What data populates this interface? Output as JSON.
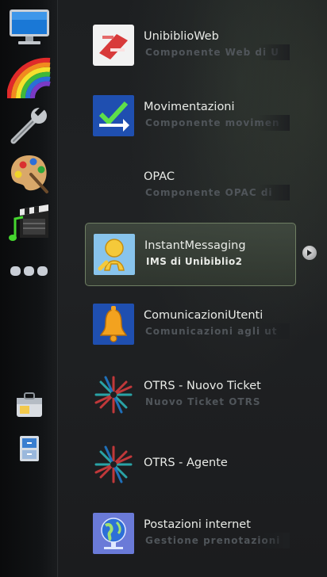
{
  "sidebar": {
    "categories": [
      {
        "icon": "computer-icon"
      },
      {
        "icon": "rainbow-icon"
      },
      {
        "icon": "wrench-icon"
      },
      {
        "icon": "palette-icon"
      },
      {
        "icon": "multimedia-icon"
      },
      {
        "icon": "more-icon"
      }
    ],
    "bottom": [
      {
        "icon": "briefcase-icon"
      },
      {
        "icon": "file-cabinet-icon"
      }
    ]
  },
  "apps": [
    {
      "title": "UnibiblioWeb",
      "subtitle": "Componente Web di U",
      "icon": "unibiblioweb-icon"
    },
    {
      "title": "Movimentazioni",
      "subtitle": "Componente movimen",
      "icon": "movimentazioni-icon"
    },
    {
      "title": "OPAC",
      "subtitle": "Componente OPAC di",
      "icon": "opac-icon"
    },
    {
      "title": "InstantMessaging",
      "subtitle": "IMS di Unibiblio2",
      "icon": "instant-messaging-icon",
      "selected": true
    },
    {
      "title": "ComunicazioniUtenti",
      "subtitle": "Comunicazioni agli ut",
      "icon": "bell-icon"
    },
    {
      "title": "OTRS - Nuovo Ticket",
      "subtitle": "Nuovo Ticket OTRS",
      "icon": "otrs-icon"
    },
    {
      "title": "OTRS - Agente",
      "subtitle": "",
      "icon": "otrs-icon"
    },
    {
      "title": "Postazioni internet",
      "subtitle": "Gestione prenotazioni",
      "icon": "globe-icon"
    }
  ],
  "colors": {
    "selected_border": "#6f7f63",
    "text": "#e9ebe7",
    "subtext": "#50555a"
  }
}
